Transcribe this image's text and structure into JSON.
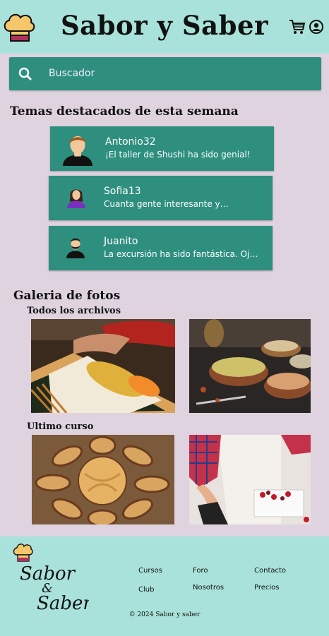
{
  "header": {
    "title": "Sabor y Saber",
    "icons": [
      "chef-hat-logo-icon",
      "cart-icon",
      "account-icon"
    ]
  },
  "search": {
    "placeholder": "Buscador"
  },
  "topics": {
    "heading": "Temas destacados de esta semana",
    "items": [
      {
        "user": "Antonio32",
        "message": "¡El taller de Shushi ha sido genial!"
      },
      {
        "user": "Sofia13",
        "message": "Cuanta gente interesante y el..."
      },
      {
        "user": "Juanito",
        "message": "La excursión ha sido fantástica. Ojal..."
      }
    ]
  },
  "gallery": {
    "heading": "Galeria de fotos",
    "all_files": "Todos los archivos",
    "last_course": "Ultimo curso"
  },
  "footer": {
    "logo_text": [
      "Sabor",
      "&",
      "Saber"
    ],
    "links": [
      "Cursos",
      "Foro",
      "Contacto",
      "Club",
      "Nosotros",
      "Precios"
    ],
    "copyright": "© 2024 Sabor y saber"
  },
  "colors": {
    "header_bg": "#a9e2da",
    "page_bg": "#ded3df",
    "accent": "#2f8f7f"
  }
}
